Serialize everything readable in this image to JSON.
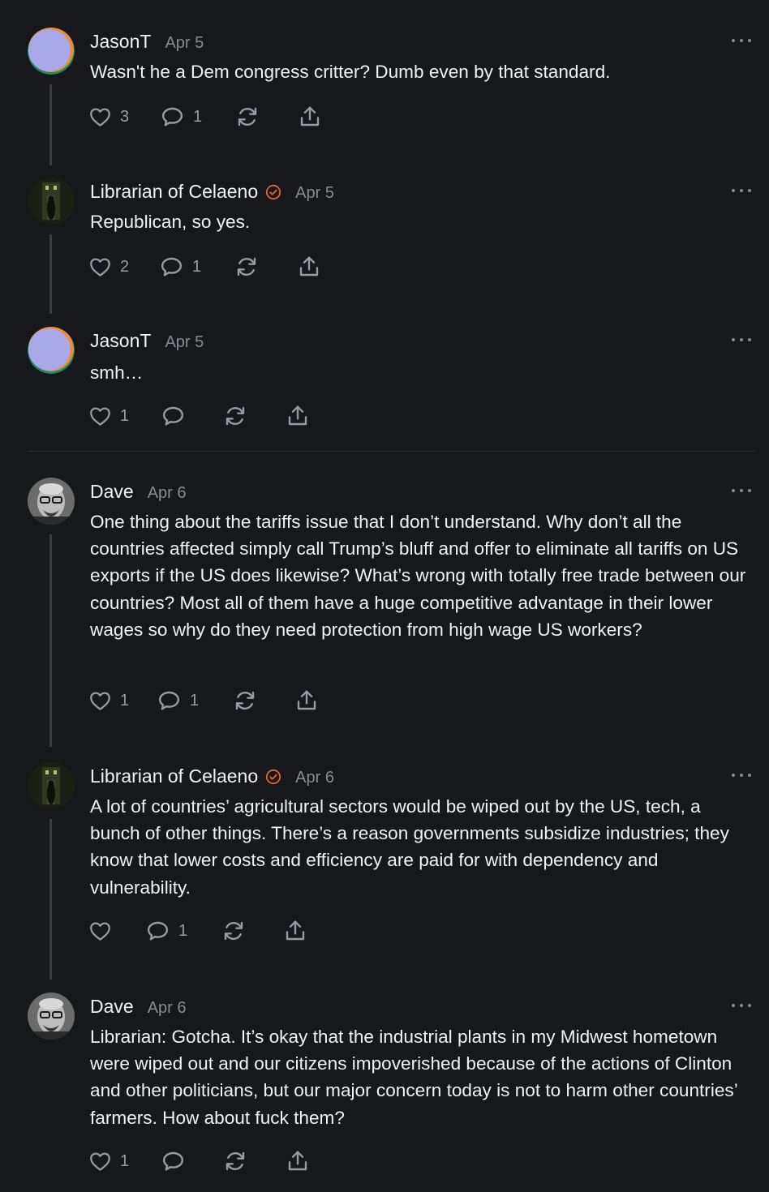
{
  "colors": {
    "background": "#17181b",
    "verified_badge": "#e8632b",
    "muted": "#8a8b90"
  },
  "comments": [
    {
      "author": "JasonT",
      "date": "Apr 5",
      "verified": false,
      "avatar_icon": "gradient-avatar",
      "text": "Wasn't he a Dem congress critter? Dumb even by that standard.",
      "likes": "3",
      "replies": "1"
    },
    {
      "author": "Librarian of Celaeno",
      "date": "Apr 5",
      "verified": true,
      "avatar_icon": "dark-corridor-avatar",
      "text": "Republican, so yes.",
      "likes": "2",
      "replies": "1"
    },
    {
      "author": "JasonT",
      "date": "Apr 5",
      "verified": false,
      "avatar_icon": "gradient-avatar",
      "text": "smh…",
      "likes": "1",
      "replies": ""
    },
    {
      "author": "Dave",
      "date": "Apr 6",
      "verified": false,
      "avatar_icon": "portrait-avatar",
      "text": "One thing about the tariffs issue that I don’t understand. Why don’t all the countries affected simply call Trump’s bluff and offer to eliminate all tariffs on US exports if the US does likewise? What’s wrong with totally free trade between our countries? Most all of them have a huge competitive advantage in their lower wages so why do they need protection from high wage US workers?",
      "likes": "1",
      "replies": "1"
    },
    {
      "author": "Librarian of Celaeno",
      "date": "Apr 6",
      "verified": true,
      "avatar_icon": "dark-corridor-avatar",
      "text": "A lot of countries’ agricultural sectors would be wiped out by the US, tech, a bunch of other things. There’s a reason governments subsidize industries; they know that lower costs and efficiency are paid for with dependency and vulnerability.",
      "likes": "",
      "replies": "1"
    },
    {
      "author": "Dave",
      "date": "Apr 6",
      "verified": false,
      "avatar_icon": "portrait-avatar",
      "text": "Librarian: Gotcha. It’s okay that the industrial plants in my Midwest hometown were wiped out and our citizens impoverished because of the actions of Clinton and other politicians, but our major concern today is not to harm other countries’ farmers. How about fuck them?",
      "likes": "1",
      "replies": ""
    }
  ]
}
